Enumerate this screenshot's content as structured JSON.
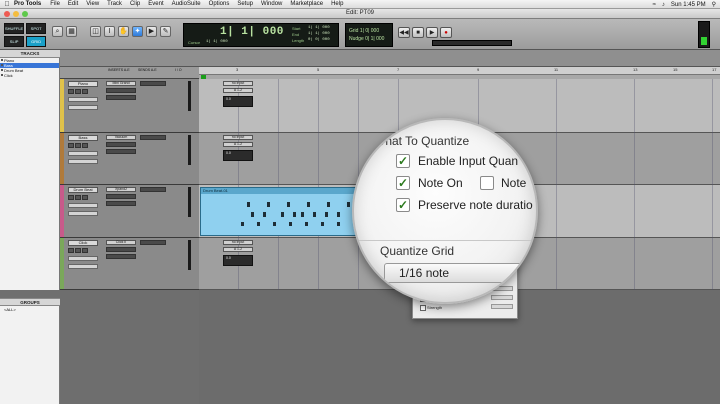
{
  "menubar": {
    "app": "Pro Tools",
    "items": [
      "File",
      "Edit",
      "View",
      "Track",
      "Clip",
      "Event",
      "AudioSuite",
      "Options",
      "Setup",
      "Window",
      "Marketplace",
      "Help"
    ],
    "clock": "Sun 1:45 PM"
  },
  "window": {
    "title": "Edit: PT09"
  },
  "toolbar": {
    "modes": [
      "SHUFFLE",
      "SPOT",
      "SLIP",
      "GRID"
    ],
    "counter_main": "1| 1| 000",
    "cursor_label": "Cursor",
    "cursor_value": "1| 1| 000",
    "start_label": "Start",
    "end_label": "End",
    "length_label": "Length",
    "start_value": "1| 1| 000",
    "end_value": "1| 1| 000",
    "length_value": "0| 0| 000",
    "grid_label": "Grid",
    "grid_value": "1| 0| 000",
    "nudge_label": "Nudge",
    "nudge_value": "0| 1| 000"
  },
  "left_panel": {
    "tracks_header": "TRACKS",
    "tracks": [
      "Piano",
      "Bass",
      "Drum Beat",
      "Click"
    ],
    "groups_header": "GROUPS",
    "groups": [
      "<ALL>"
    ]
  },
  "column_headers": [
    "INSERTS A-E",
    "SENDS A-E",
    "I / O"
  ],
  "ruler": {
    "ticks": [
      "3",
      "5",
      "7",
      "9",
      "11",
      "13",
      "15",
      "17"
    ]
  },
  "edit_tracks": [
    {
      "name": "Piano",
      "insert": "Mini Grand",
      "io_in": "no input",
      "io_out": "A 1-2",
      "vol": "0.0",
      "color": "#e0c24a"
    },
    {
      "name": "Bass",
      "insert": "Vacuum",
      "io_in": "no input",
      "io_out": "A 1-2",
      "vol": "0.0",
      "color": "#b07a3a"
    },
    {
      "name": "Drum Beat",
      "insert": "Xpand2",
      "io_in": "no input",
      "io_out": "A 1-2",
      "vol": "0.0",
      "color": "#c85a8a"
    },
    {
      "name": "Click",
      "insert": "Click II",
      "io_in": "no input",
      "io_out": "A 1-2",
      "vol": "0.0",
      "color": "#7aa85a"
    }
  ],
  "clip": {
    "name": "Drum Beat-01"
  },
  "magnifier": {
    "heading": "What To Quantize",
    "enable_input_label": "Enable Input Quan",
    "note_on_label": "Note On",
    "note_off_label": "Note",
    "preserve_label": "Preserve note duratio",
    "grid_label": "Quantize Grid",
    "grid_value": "1/16 note"
  },
  "dialog_rows": [
    "Exclude within",
    "Strength"
  ]
}
